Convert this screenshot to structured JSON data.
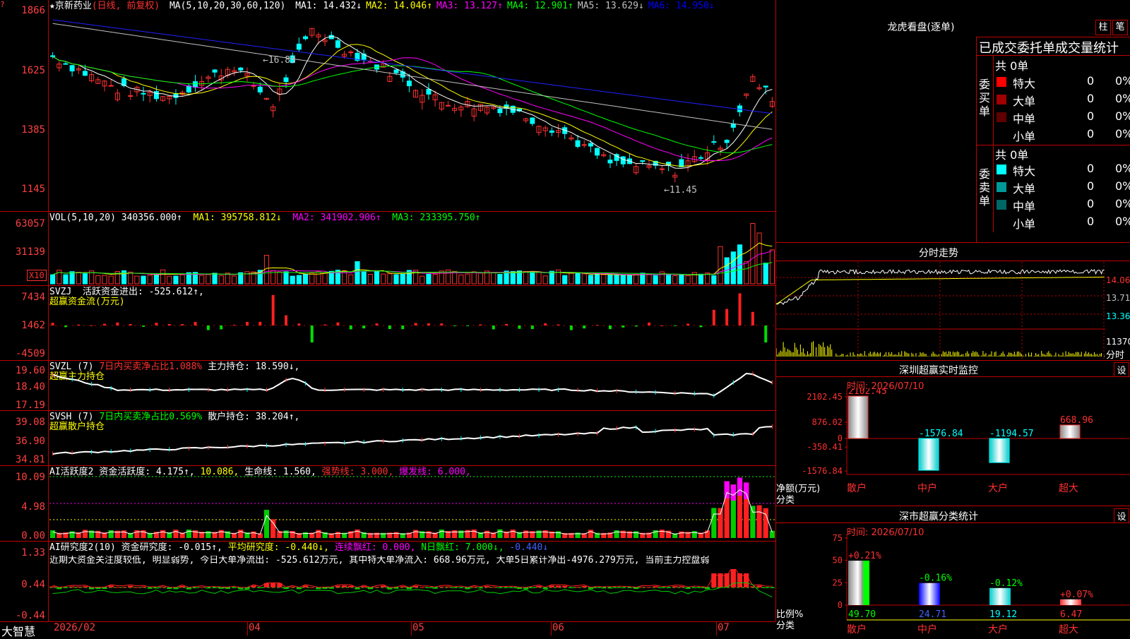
{
  "main": {
    "stock_name": "京新药业",
    "mode": "(日线, 前复权)",
    "ma_label": "MA(5,10,20,30,60,120)",
    "ma": [
      {
        "name": "MA1",
        "value": "14.432↓",
        "color": "#ffffff"
      },
      {
        "name": "MA2",
        "value": "14.046↑",
        "color": "#ffff00"
      },
      {
        "name": "MA3",
        "value": "13.127↑",
        "color": "#ff00ff"
      },
      {
        "name": "MA4",
        "value": "12.901↑",
        "color": "#00ff00"
      },
      {
        "name": "MA5",
        "value": "13.629↓",
        "color": "#c0c0c0"
      },
      {
        "name": "MA6",
        "value": "14.950↓",
        "color": "#0000ff"
      }
    ],
    "y_ticks": [
      "1866",
      "1625",
      "1385",
      "1145"
    ],
    "high_label": "16.83",
    "low_label": "11.45"
  },
  "vol": {
    "label": "VOL(5,10,20)",
    "value": "340356.000↑",
    "ma1": "MA1: 395758.812↓",
    "ma2": "MA2: 341902.906↑",
    "ma3": "MA3: 233395.750↑",
    "y_ticks": [
      "63057",
      "31139"
    ],
    "unit": "X10"
  },
  "svzj": {
    "name": "SVZJ",
    "desc": "活跃资金进出: -525.612↑,",
    "title": "超赢资金流(万元)",
    "y_ticks": [
      "7434",
      "1462",
      "-4509"
    ]
  },
  "svzl": {
    "name": "SVZL (7)",
    "ratio": "7日内买卖净占比1.088%",
    "hold": "主力持仓: 18.590↓,",
    "title": "超赢主力持仓",
    "y_ticks": [
      "19.60",
      "18.40",
      "17.19"
    ]
  },
  "svsh": {
    "name": "SVSH (7)",
    "ratio": "7日内买卖净占比0.569%",
    "hold": "散户持仓: 38.204↑,",
    "title": "超赢散户持仓",
    "y_ticks": [
      "39.08",
      "36.90",
      "34.81"
    ]
  },
  "ai1": {
    "label": "AI活跃度2",
    "v1": "资金活跃度: 4.175↑,",
    "v2": "10.086,",
    "v3": "生命线: 1.560,",
    "v4": "强势线: 3.000,",
    "v5": "爆发线: 6.000,",
    "y_ticks": [
      "10.09",
      "4.98",
      "0.00"
    ]
  },
  "ai2": {
    "label": "AI研究度2(10)",
    "v1": "资金研究度: -0.015↑,",
    "v2": "平均研究度: -0.440↓,",
    "v3": "连续飘红: 0.000,",
    "v4": "N日飘红: 7.000↓,",
    "v5": "-0.440↓",
    "note": "近期大资金关注度较低, 明显弱势, 今日大单净流出: -525.612万元, 其中特大单净流入: 668.96万元, 大单5日累计净出-4976.279万元, 当前主力控盘弱",
    "y_ticks": [
      "1.33",
      "0.44",
      "-0.44"
    ]
  },
  "x_axis": {
    "labels": [
      "2026/02",
      "04",
      "05",
      "06",
      "07"
    ],
    "brand": "大智慧"
  },
  "right": {
    "dragon_title": "龙虎看盘(逐单)",
    "btn_bar": "柱",
    "btn_pen": "笔",
    "header": "已成交委托单成交量统计",
    "buy": {
      "side": "委买单",
      "total": "共 0单",
      "rows": [
        {
          "label": "特大",
          "count": "0",
          "pct": "0%",
          "color": "#ff0000"
        },
        {
          "label": "大单",
          "count": "0",
          "pct": "0%",
          "color": "#a00000"
        },
        {
          "label": "中单",
          "count": "0",
          "pct": "0%",
          "color": "#600000"
        },
        {
          "label": "小单",
          "count": "0",
          "pct": "0%",
          "color": ""
        }
      ]
    },
    "sell": {
      "side": "委卖单",
      "total": "共 0单",
      "rows": [
        {
          "label": "特大",
          "count": "0",
          "pct": "0%",
          "color": "#00ffff"
        },
        {
          "label": "大单",
          "count": "0",
          "pct": "0%",
          "color": "#009999"
        },
        {
          "label": "中单",
          "count": "0",
          "pct": "0%",
          "color": "#006666"
        },
        {
          "label": "小单",
          "count": "0",
          "pct": "0%",
          "color": ""
        }
      ]
    },
    "intraday": {
      "title": "分时走势",
      "prices": [
        "14.06",
        "13.71",
        "13.36"
      ],
      "vol": "11370",
      "vol_unit": "分时"
    },
    "monitor": {
      "title": "深圳超赢实时监控",
      "set": "设",
      "time": "时间: 2026/07/10",
      "y_ticks": [
        "2102.45",
        "876.02",
        "0",
        "-350.41",
        "-1576.84"
      ],
      "unit": "净额(万元)",
      "cat_label": "分类",
      "categories": [
        "散户",
        "中户",
        "大户",
        "超大"
      ],
      "values": [
        "2102.45",
        "-1576.84",
        "-1194.57",
        "668.96"
      ]
    },
    "stats": {
      "title": "深市超赢分类统计",
      "set": "设",
      "time": "时间: 2026/07/10",
      "y_ticks": [
        "75",
        "50",
        "25",
        "0"
      ],
      "unit": "比例%",
      "cat_label": "分类",
      "categories": [
        "散户",
        "中户",
        "大户",
        "超大"
      ],
      "changes": [
        "+0.21%",
        "-0.16%",
        "-0.12%",
        "+0.07%"
      ],
      "values": [
        "49.70",
        "24.71",
        "19.12",
        "6.47"
      ]
    }
  }
}
